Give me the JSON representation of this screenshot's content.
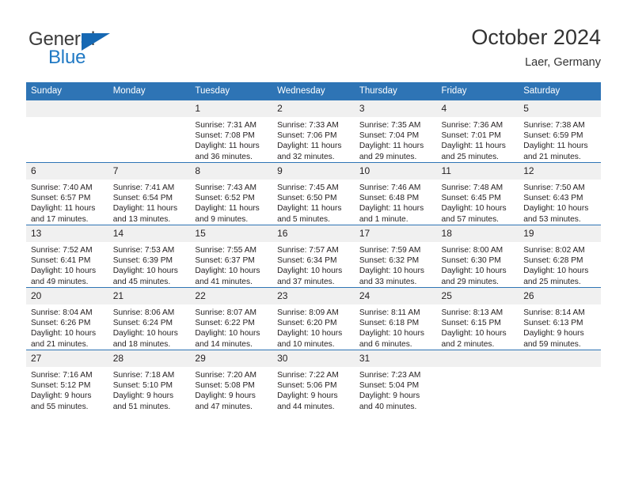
{
  "brand": {
    "name_top": "General",
    "name_bottom": "Blue",
    "triangle_icon": "triangle-icon",
    "color_dark": "#3b3b3b",
    "color_blue": "#2079c4"
  },
  "header": {
    "title": "October 2024",
    "subtitle": "Laer, Germany"
  },
  "theme": {
    "header_blue": "#2e74b5",
    "daynum_band": "#f0f0f0",
    "text": "#231f20"
  },
  "weekday_headers": [
    "Sunday",
    "Monday",
    "Tuesday",
    "Wednesday",
    "Thursday",
    "Friday",
    "Saturday"
  ],
  "weeks": [
    [
      {
        "day": "",
        "sunrise": "",
        "sunset": "",
        "daylight_line1": "",
        "daylight_line2": "",
        "empty": true
      },
      {
        "day": "",
        "sunrise": "",
        "sunset": "",
        "daylight_line1": "",
        "daylight_line2": "",
        "empty": true
      },
      {
        "day": "1",
        "sunrise": "Sunrise: 7:31 AM",
        "sunset": "Sunset: 7:08 PM",
        "daylight_line1": "Daylight: 11 hours",
        "daylight_line2": "and 36 minutes."
      },
      {
        "day": "2",
        "sunrise": "Sunrise: 7:33 AM",
        "sunset": "Sunset: 7:06 PM",
        "daylight_line1": "Daylight: 11 hours",
        "daylight_line2": "and 32 minutes."
      },
      {
        "day": "3",
        "sunrise": "Sunrise: 7:35 AM",
        "sunset": "Sunset: 7:04 PM",
        "daylight_line1": "Daylight: 11 hours",
        "daylight_line2": "and 29 minutes."
      },
      {
        "day": "4",
        "sunrise": "Sunrise: 7:36 AM",
        "sunset": "Sunset: 7:01 PM",
        "daylight_line1": "Daylight: 11 hours",
        "daylight_line2": "and 25 minutes."
      },
      {
        "day": "5",
        "sunrise": "Sunrise: 7:38 AM",
        "sunset": "Sunset: 6:59 PM",
        "daylight_line1": "Daylight: 11 hours",
        "daylight_line2": "and 21 minutes."
      }
    ],
    [
      {
        "day": "6",
        "sunrise": "Sunrise: 7:40 AM",
        "sunset": "Sunset: 6:57 PM",
        "daylight_line1": "Daylight: 11 hours",
        "daylight_line2": "and 17 minutes."
      },
      {
        "day": "7",
        "sunrise": "Sunrise: 7:41 AM",
        "sunset": "Sunset: 6:54 PM",
        "daylight_line1": "Daylight: 11 hours",
        "daylight_line2": "and 13 minutes."
      },
      {
        "day": "8",
        "sunrise": "Sunrise: 7:43 AM",
        "sunset": "Sunset: 6:52 PM",
        "daylight_line1": "Daylight: 11 hours",
        "daylight_line2": "and 9 minutes."
      },
      {
        "day": "9",
        "sunrise": "Sunrise: 7:45 AM",
        "sunset": "Sunset: 6:50 PM",
        "daylight_line1": "Daylight: 11 hours",
        "daylight_line2": "and 5 minutes."
      },
      {
        "day": "10",
        "sunrise": "Sunrise: 7:46 AM",
        "sunset": "Sunset: 6:48 PM",
        "daylight_line1": "Daylight: 11 hours",
        "daylight_line2": "and 1 minute."
      },
      {
        "day": "11",
        "sunrise": "Sunrise: 7:48 AM",
        "sunset": "Sunset: 6:45 PM",
        "daylight_line1": "Daylight: 10 hours",
        "daylight_line2": "and 57 minutes."
      },
      {
        "day": "12",
        "sunrise": "Sunrise: 7:50 AM",
        "sunset": "Sunset: 6:43 PM",
        "daylight_line1": "Daylight: 10 hours",
        "daylight_line2": "and 53 minutes."
      }
    ],
    [
      {
        "day": "13",
        "sunrise": "Sunrise: 7:52 AM",
        "sunset": "Sunset: 6:41 PM",
        "daylight_line1": "Daylight: 10 hours",
        "daylight_line2": "and 49 minutes."
      },
      {
        "day": "14",
        "sunrise": "Sunrise: 7:53 AM",
        "sunset": "Sunset: 6:39 PM",
        "daylight_line1": "Daylight: 10 hours",
        "daylight_line2": "and 45 minutes."
      },
      {
        "day": "15",
        "sunrise": "Sunrise: 7:55 AM",
        "sunset": "Sunset: 6:37 PM",
        "daylight_line1": "Daylight: 10 hours",
        "daylight_line2": "and 41 minutes."
      },
      {
        "day": "16",
        "sunrise": "Sunrise: 7:57 AM",
        "sunset": "Sunset: 6:34 PM",
        "daylight_line1": "Daylight: 10 hours",
        "daylight_line2": "and 37 minutes."
      },
      {
        "day": "17",
        "sunrise": "Sunrise: 7:59 AM",
        "sunset": "Sunset: 6:32 PM",
        "daylight_line1": "Daylight: 10 hours",
        "daylight_line2": "and 33 minutes."
      },
      {
        "day": "18",
        "sunrise": "Sunrise: 8:00 AM",
        "sunset": "Sunset: 6:30 PM",
        "daylight_line1": "Daylight: 10 hours",
        "daylight_line2": "and 29 minutes."
      },
      {
        "day": "19",
        "sunrise": "Sunrise: 8:02 AM",
        "sunset": "Sunset: 6:28 PM",
        "daylight_line1": "Daylight: 10 hours",
        "daylight_line2": "and 25 minutes."
      }
    ],
    [
      {
        "day": "20",
        "sunrise": "Sunrise: 8:04 AM",
        "sunset": "Sunset: 6:26 PM",
        "daylight_line1": "Daylight: 10 hours",
        "daylight_line2": "and 21 minutes."
      },
      {
        "day": "21",
        "sunrise": "Sunrise: 8:06 AM",
        "sunset": "Sunset: 6:24 PM",
        "daylight_line1": "Daylight: 10 hours",
        "daylight_line2": "and 18 minutes."
      },
      {
        "day": "22",
        "sunrise": "Sunrise: 8:07 AM",
        "sunset": "Sunset: 6:22 PM",
        "daylight_line1": "Daylight: 10 hours",
        "daylight_line2": "and 14 minutes."
      },
      {
        "day": "23",
        "sunrise": "Sunrise: 8:09 AM",
        "sunset": "Sunset: 6:20 PM",
        "daylight_line1": "Daylight: 10 hours",
        "daylight_line2": "and 10 minutes."
      },
      {
        "day": "24",
        "sunrise": "Sunrise: 8:11 AM",
        "sunset": "Sunset: 6:18 PM",
        "daylight_line1": "Daylight: 10 hours",
        "daylight_line2": "and 6 minutes."
      },
      {
        "day": "25",
        "sunrise": "Sunrise: 8:13 AM",
        "sunset": "Sunset: 6:15 PM",
        "daylight_line1": "Daylight: 10 hours",
        "daylight_line2": "and 2 minutes."
      },
      {
        "day": "26",
        "sunrise": "Sunrise: 8:14 AM",
        "sunset": "Sunset: 6:13 PM",
        "daylight_line1": "Daylight: 9 hours",
        "daylight_line2": "and 59 minutes."
      }
    ],
    [
      {
        "day": "27",
        "sunrise": "Sunrise: 7:16 AM",
        "sunset": "Sunset: 5:12 PM",
        "daylight_line1": "Daylight: 9 hours",
        "daylight_line2": "and 55 minutes."
      },
      {
        "day": "28",
        "sunrise": "Sunrise: 7:18 AM",
        "sunset": "Sunset: 5:10 PM",
        "daylight_line1": "Daylight: 9 hours",
        "daylight_line2": "and 51 minutes."
      },
      {
        "day": "29",
        "sunrise": "Sunrise: 7:20 AM",
        "sunset": "Sunset: 5:08 PM",
        "daylight_line1": "Daylight: 9 hours",
        "daylight_line2": "and 47 minutes."
      },
      {
        "day": "30",
        "sunrise": "Sunrise: 7:22 AM",
        "sunset": "Sunset: 5:06 PM",
        "daylight_line1": "Daylight: 9 hours",
        "daylight_line2": "and 44 minutes."
      },
      {
        "day": "31",
        "sunrise": "Sunrise: 7:23 AM",
        "sunset": "Sunset: 5:04 PM",
        "daylight_line1": "Daylight: 9 hours",
        "daylight_line2": "and 40 minutes."
      },
      {
        "day": "",
        "sunrise": "",
        "sunset": "",
        "daylight_line1": "",
        "daylight_line2": "",
        "empty": true
      },
      {
        "day": "",
        "sunrise": "",
        "sunset": "",
        "daylight_line1": "",
        "daylight_line2": "",
        "empty": true
      }
    ]
  ]
}
